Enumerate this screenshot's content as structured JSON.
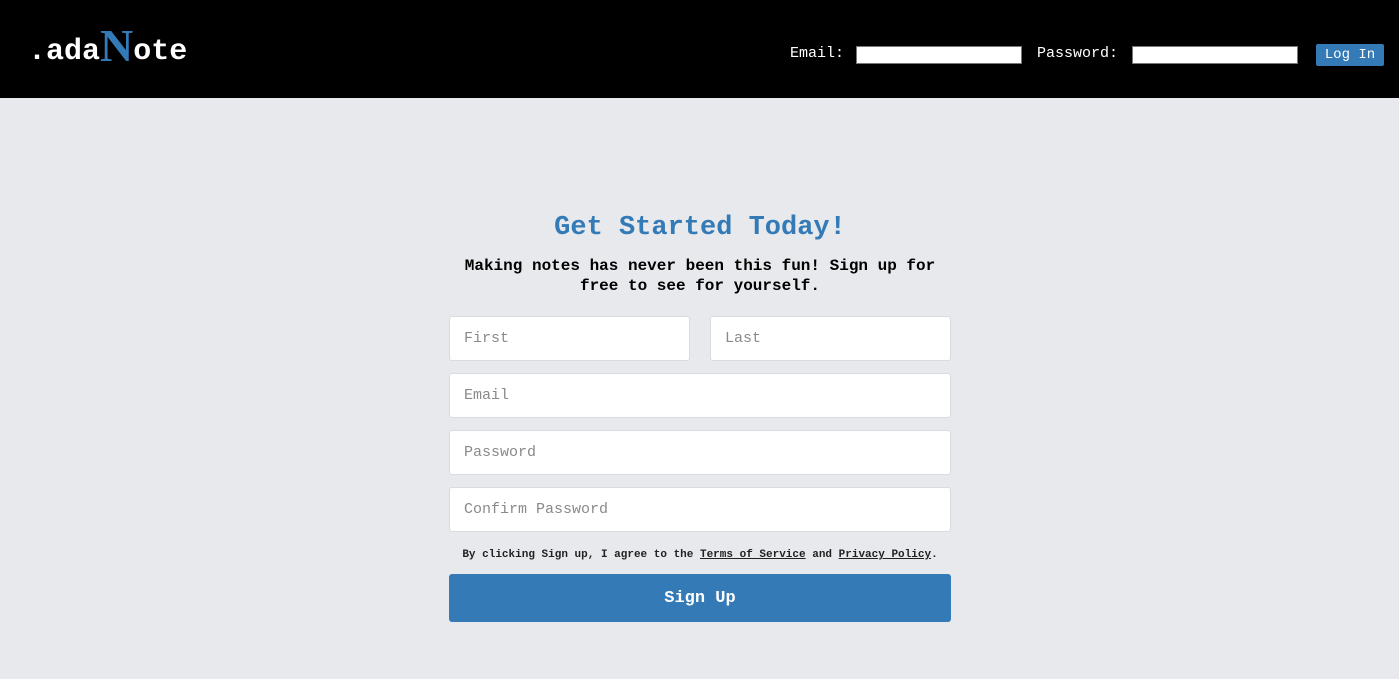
{
  "header": {
    "logo": {
      "prefix": ".ada",
      "accent_letter": "N",
      "suffix": "ote"
    },
    "login": {
      "email_label": "Email:",
      "email_value": "",
      "password_label": "Password:",
      "password_value": "",
      "button_label": "Log In"
    }
  },
  "signup": {
    "title": "Get Started Today!",
    "subtitle": "Making notes has never been this fun! Sign up for free to see for yourself.",
    "fields": {
      "first_placeholder": "First",
      "last_placeholder": "Last",
      "email_placeholder": "Email",
      "password_placeholder": "Password",
      "confirm_placeholder": "Confirm Password"
    },
    "terms": {
      "prefix": "By clicking Sign up, I agree to the",
      "tos_link": "Terms of Service",
      "and": "and",
      "privacy_link": "Privacy Policy",
      "suffix": "."
    },
    "button_label": "Sign Up"
  },
  "colors": {
    "accent": "#337ab7",
    "header_bg": "#000000",
    "page_bg": "#e8e9ec"
  }
}
